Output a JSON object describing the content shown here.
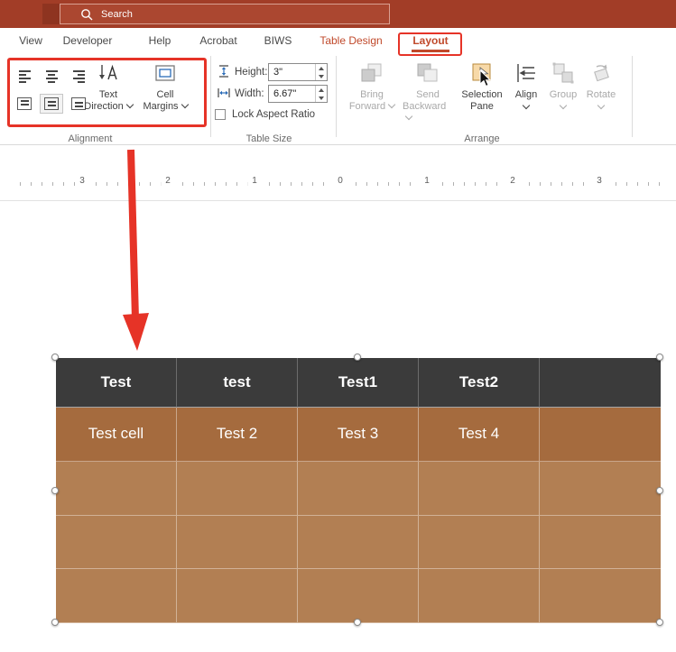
{
  "titlebar": {
    "search_label": "Search"
  },
  "tabs": {
    "view": "View",
    "developer": "Developer",
    "help": "Help",
    "acrobat": "Acrobat",
    "biws": "BIWS",
    "table_design": "Table Design",
    "layout": "Layout"
  },
  "ribbon": {
    "alignment": {
      "group_label": "Alignment",
      "text_direction_line1": "Text",
      "text_direction_line2": "Direction",
      "cell_margins_line1": "Cell",
      "cell_margins_line2": "Margins"
    },
    "table_size": {
      "group_label": "Table Size",
      "height_label": "Height:",
      "height_value": "3\"",
      "width_label": "Width:",
      "width_value": "6.67\"",
      "lock_aspect_ratio_label": "Lock Aspect Ratio"
    },
    "arrange": {
      "group_label": "Arrange",
      "bring_forward_line1": "Bring",
      "bring_forward_line2": "Forward",
      "send_backward_line1": "Send",
      "send_backward_line2": "Backward",
      "selection_pane_line1": "Selection",
      "selection_pane_line2": "Pane",
      "align_label": "Align",
      "group_button_label": "Group",
      "rotate_label": "Rotate"
    }
  },
  "ruler": {
    "marks": [
      "3",
      "2",
      "1",
      "0",
      "1",
      "2",
      "3"
    ]
  },
  "slide": {
    "table": {
      "header": [
        "Test",
        "test",
        "Test1",
        "Test2",
        ""
      ],
      "rows": [
        [
          "Test cell",
          "Test 2",
          "Test 3",
          "Test 4",
          ""
        ],
        [
          "",
          "",
          "",
          "",
          ""
        ],
        [
          "",
          "",
          "",
          "",
          ""
        ],
        [
          "",
          "",
          "",
          "",
          ""
        ]
      ]
    }
  },
  "colors": {
    "titlebar_bg": "#a23d27",
    "tab_accent": "#c0492b",
    "annotation_red": "#e63327",
    "table_header_bg": "#3b3b3b",
    "table_row_first_bg": "#a56b3e",
    "table_row_bg": "#b27f53"
  }
}
